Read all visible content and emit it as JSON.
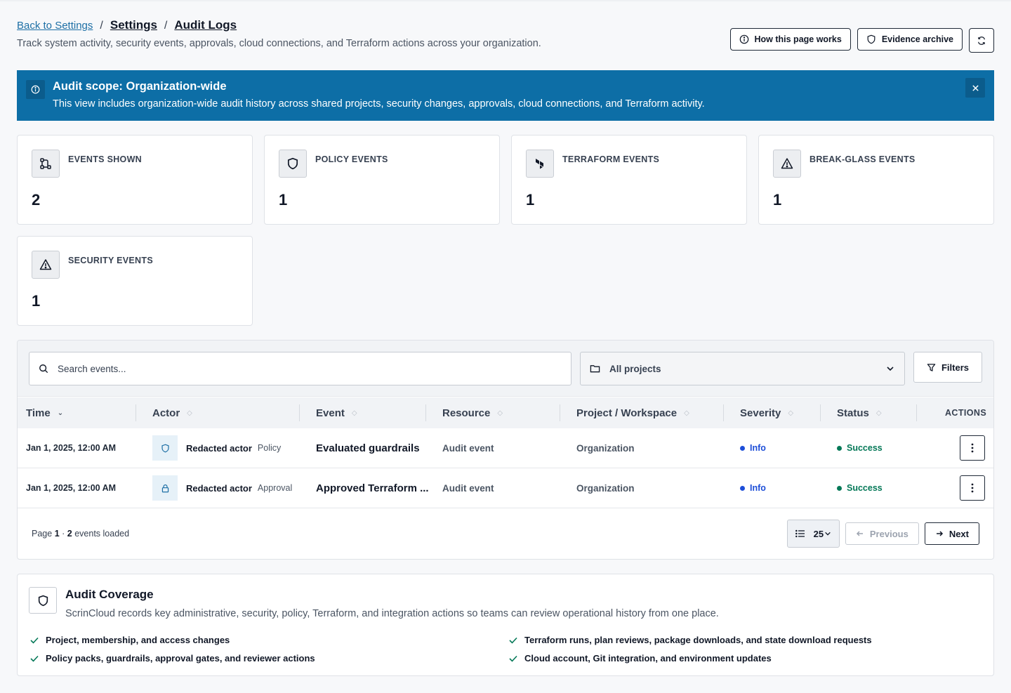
{
  "breadcrumb": {
    "back": "Back to Settings",
    "sep": "/",
    "settings": "Settings",
    "current": "Audit Logs"
  },
  "subtitle": "Track system activity, security events, approvals, cloud connections, and Terraform actions across your organization.",
  "header_actions": {
    "how": "How this page works",
    "evidence": "Evidence archive"
  },
  "banner": {
    "title": "Audit scope: Organization-wide",
    "text": "This view includes organization-wide audit history across shared projects, security changes, approvals, cloud connections, and Terraform activity."
  },
  "stats": [
    {
      "label": "EVENTS SHOWN",
      "value": "2",
      "icon": "workflow-icon"
    },
    {
      "label": "POLICY EVENTS",
      "value": "1",
      "icon": "shield-icon"
    },
    {
      "label": "TERRAFORM EVENTS",
      "value": "1",
      "icon": "terraform-icon"
    },
    {
      "label": "BREAK-GLASS EVENTS",
      "value": "1",
      "icon": "warning-icon"
    },
    {
      "label": "SECURITY EVENTS",
      "value": "1",
      "icon": "warning-icon"
    }
  ],
  "toolbar": {
    "search_placeholder": "Search events...",
    "project_filter": "All projects",
    "filters": "Filters"
  },
  "columns": {
    "time": "Time",
    "actor": "Actor",
    "event": "Event",
    "resource": "Resource",
    "project": "Project / Workspace",
    "severity": "Severity",
    "status": "Status",
    "actions": "ACTIONS"
  },
  "rows": [
    {
      "time": "Jan 1, 2025, 12:00 AM",
      "actor": "Redacted actor",
      "actor_tag": "Policy",
      "actor_icon": "shield-icon",
      "event": "Evaluated guardrails",
      "resource": "Audit event",
      "project": "Organization",
      "severity": "Info",
      "status": "Success"
    },
    {
      "time": "Jan 1, 2025, 12:00 AM",
      "actor": "Redacted actor",
      "actor_tag": "Approval",
      "actor_icon": "lock-icon",
      "event": "Approved Terraform ...",
      "resource": "Audit event",
      "project": "Organization",
      "severity": "Info",
      "status": "Success"
    }
  ],
  "footer": {
    "page_label": "Page",
    "page": "1",
    "dot": "·",
    "count": "2",
    "loaded_label": "events loaded",
    "page_size": "25",
    "previous": "Previous",
    "next": "Next"
  },
  "coverage": {
    "title": "Audit Coverage",
    "desc": "ScrinCloud records key administrative, security, policy, Terraform, and integration actions so teams can review operational history from one place.",
    "items": [
      "Project, membership, and access changes",
      "Terraform runs, plan reviews, package downloads, and state download requests",
      "Policy packs, guardrails, approval gates, and reviewer actions",
      "Cloud account, Git integration, and environment updates"
    ]
  },
  "colors": {
    "banner": "#0d6ea6",
    "info": "#1d4ed8",
    "success": "#047857",
    "link": "#1d6fa5"
  }
}
